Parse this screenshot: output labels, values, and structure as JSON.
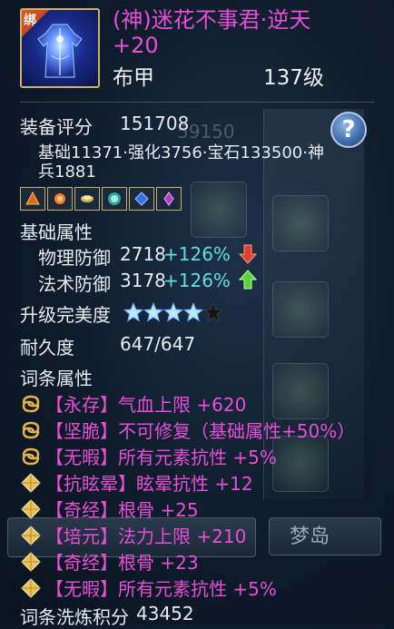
{
  "background": {
    "dream_island_button": "梦岛",
    "ghost_score": "59150"
  },
  "item": {
    "bind_label": "绑",
    "name": "(神)迷花不事君·逆天 +20",
    "type": "布甲",
    "level": "137级"
  },
  "rating": {
    "label": "装备评分",
    "value": "151708",
    "breakdown": "基础11371·强化3756·宝石133500·神兵1881",
    "help_symbol": "?"
  },
  "gem_icons": [
    "gem-fire-icon",
    "gem-flame-icon",
    "gem-gold-icon",
    "gem-jade-icon",
    "gem-blue-icon",
    "gem-purple-icon"
  ],
  "base_attributes": {
    "label": "基础属性",
    "physical": {
      "name": "物理防御",
      "value": "2718",
      "bonus": "+126%",
      "trend": "down"
    },
    "magic": {
      "name": "法术防御",
      "value": "3178",
      "bonus": "+126%",
      "trend": "up"
    }
  },
  "perfection": {
    "label": "升级完美度",
    "stars_filled": 4,
    "stars_total": 5
  },
  "durability": {
    "label": "耐久度",
    "value": "647/647"
  },
  "affixes": {
    "label": "词条属性",
    "items": [
      {
        "icon": "swirl",
        "text": "【永存】气血上限 +620"
      },
      {
        "icon": "swirl",
        "text": "【坚脆】不可修复（基础属性+50%）"
      },
      {
        "icon": "swirl",
        "text": "【无暇】所有元素抗性 +5%"
      },
      {
        "icon": "diamond",
        "text": "【抗眩晕】眩晕抗性 +12"
      },
      {
        "icon": "diamond",
        "text": "【奇经】根骨 +25"
      },
      {
        "icon": "diamond",
        "text": "【培元】法力上限 +210"
      },
      {
        "icon": "diamond",
        "text": "【奇经】根骨 +23"
      },
      {
        "icon": "diamond",
        "text": "【无暇】所有元素抗性 +5%"
      }
    ]
  },
  "refine": {
    "label": "词条洗炼积分",
    "value": "43452"
  },
  "colors": {
    "accent_magenta": "#e64fd6",
    "bonus_cyan": "#5fe0d8",
    "gold_border": "#c9b36a"
  }
}
